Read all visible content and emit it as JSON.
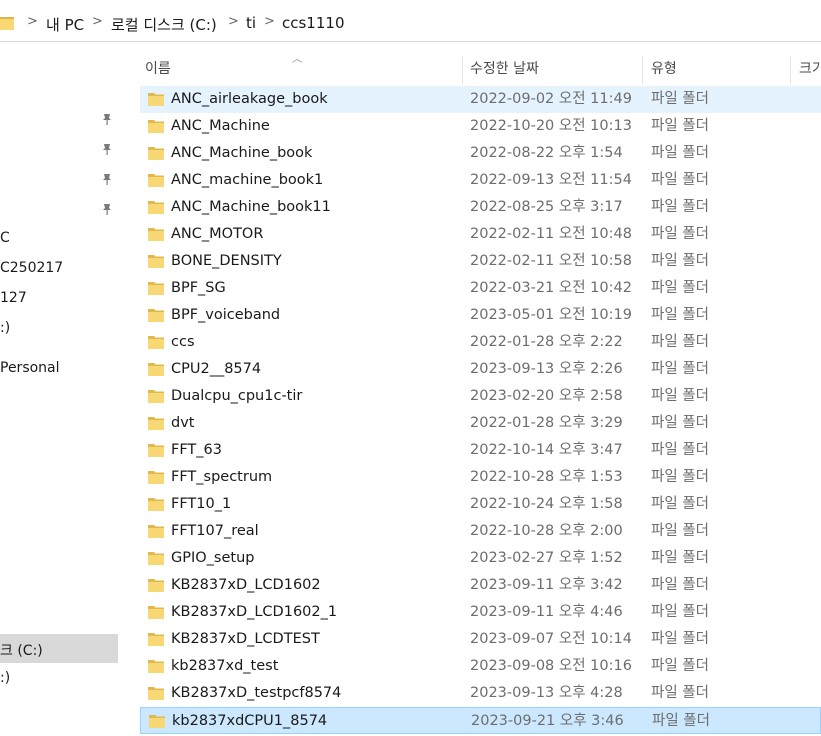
{
  "address": {
    "crumbs": [
      "내 PC",
      "로컬 디스크 (C:)",
      "ti",
      "ccs1110"
    ],
    "separator": ">"
  },
  "nav": {
    "items": [
      {
        "label": "C"
      },
      {
        "label": "C250217"
      },
      {
        "label": "127"
      },
      {
        "label": ":)"
      },
      {
        "label": "Personal"
      },
      {
        "label": "크 (C:)"
      },
      {
        "label": ":)"
      }
    ]
  },
  "header": {
    "name": "이름",
    "date": "수정한 날짜",
    "type": "유형",
    "size": "크기"
  },
  "files": [
    {
      "name": "ANC_airleakage_book",
      "date": "2022-09-02 오전 11:49",
      "type": "파일 폴더"
    },
    {
      "name": "ANC_Machine",
      "date": "2022-10-20 오전 10:13",
      "type": "파일 폴더"
    },
    {
      "name": "ANC_Machine_book",
      "date": "2022-08-22 오후 1:54",
      "type": "파일 폴더"
    },
    {
      "name": "ANC_machine_book1",
      "date": "2022-09-13 오전 11:54",
      "type": "파일 폴더"
    },
    {
      "name": "ANC_Machine_book11",
      "date": "2022-08-25 오후 3:17",
      "type": "파일 폴더"
    },
    {
      "name": "ANC_MOTOR",
      "date": "2022-02-11 오전 10:48",
      "type": "파일 폴더"
    },
    {
      "name": "BONE_DENSITY",
      "date": "2022-02-11 오전 10:58",
      "type": "파일 폴더"
    },
    {
      "name": "BPF_SG",
      "date": "2022-03-21 오전 10:42",
      "type": "파일 폴더"
    },
    {
      "name": "BPF_voiceband",
      "date": "2023-05-01 오전 10:19",
      "type": "파일 폴더"
    },
    {
      "name": "ccs",
      "date": "2022-01-28 오후 2:22",
      "type": "파일 폴더"
    },
    {
      "name": "CPU2__8574",
      "date": "2023-09-13 오후 2:26",
      "type": "파일 폴더"
    },
    {
      "name": "Dualcpu_cpu1c-tir",
      "date": "2023-02-20 오후 2:58",
      "type": "파일 폴더"
    },
    {
      "name": "dvt",
      "date": "2022-01-28 오후 3:29",
      "type": "파일 폴더"
    },
    {
      "name": "FFT_63",
      "date": "2022-10-14 오후 3:47",
      "type": "파일 폴더"
    },
    {
      "name": "FFT_spectrum",
      "date": "2022-10-28 오후 1:53",
      "type": "파일 폴더"
    },
    {
      "name": "FFT10_1",
      "date": "2022-10-24 오후 1:58",
      "type": "파일 폴더"
    },
    {
      "name": "FFT107_real",
      "date": "2022-10-28 오후 2:00",
      "type": "파일 폴더"
    },
    {
      "name": "GPIO_setup",
      "date": "2023-02-27 오후 1:52",
      "type": "파일 폴더"
    },
    {
      "name": "KB2837xD_LCD1602",
      "date": "2023-09-11 오후 3:42",
      "type": "파일 폴더"
    },
    {
      "name": "KB2837xD_LCD1602_1",
      "date": "2023-09-11 오후 4:46",
      "type": "파일 폴더"
    },
    {
      "name": "KB2837xD_LCDTEST",
      "date": "2023-09-07 오전 10:14",
      "type": "파일 폴더"
    },
    {
      "name": "kb2837xd_test",
      "date": "2023-09-08 오전 10:16",
      "type": "파일 폴더"
    },
    {
      "name": "KB2837xD_testpcf8574",
      "date": "2023-09-13 오후 4:28",
      "type": "파일 폴더"
    },
    {
      "name": "kb2837xdCPU1_8574",
      "date": "2023-09-21 오후 3:46",
      "type": "파일 폴더"
    }
  ],
  "icons": {
    "folder": "folder-icon",
    "pin": "pin-icon"
  },
  "colors": {
    "folder": "#f8d775",
    "hover_row": "#e5f3ff",
    "selected_row": "#cce8ff",
    "selected_border": "#99d1ff"
  }
}
